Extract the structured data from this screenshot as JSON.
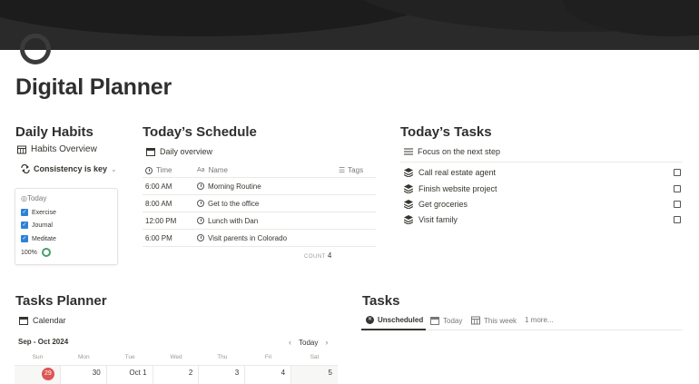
{
  "page": {
    "title": "Digital Planner"
  },
  "habits": {
    "heading": "Daily Habits",
    "view": "Habits Overview",
    "filter": "Consistency is key",
    "card": {
      "title": "Today",
      "items": [
        "Exercise",
        "Journal",
        "Meditate"
      ],
      "progress_label": "100%",
      "progress": 1.0
    }
  },
  "schedule": {
    "heading": "Today’s Schedule",
    "view": "Daily overview",
    "columns": {
      "time": "Time",
      "name": "Name",
      "tags": "Tags"
    },
    "rows": [
      {
        "time": "6:00 AM",
        "name": "Morning Routine"
      },
      {
        "time": "8:00 AM",
        "name": "Get to the office"
      },
      {
        "time": "12:00 PM",
        "name": "Lunch with Dan"
      },
      {
        "time": "6:00 PM",
        "name": "Visit parents in Colorado"
      }
    ],
    "count_label": "COUNT",
    "count_value": "4"
  },
  "tasks_today": {
    "heading": "Today’s Tasks",
    "view": "Focus on the next step",
    "items": [
      "Call real estate agent",
      "Finish website project",
      "Get groceries",
      "Visit family"
    ]
  },
  "planner": {
    "heading": "Tasks Planner",
    "view": "Calendar",
    "range": "Sep - Oct 2024",
    "today_label": "Today",
    "weekdays": [
      "Sun",
      "Mon",
      "Tue",
      "Wed",
      "Thu",
      "Fri",
      "Sat"
    ],
    "week": [
      "29",
      "30",
      "Oct 1",
      "2",
      "3",
      "4",
      "5"
    ]
  },
  "tasks": {
    "heading": "Tasks",
    "tabs": [
      "Unscheduled",
      "Today",
      "This week",
      "1 more..."
    ]
  },
  "colors": {
    "accent_blue": "#2e82d6",
    "today_red": "#e05555",
    "ring_green": "#4b9c6f"
  }
}
